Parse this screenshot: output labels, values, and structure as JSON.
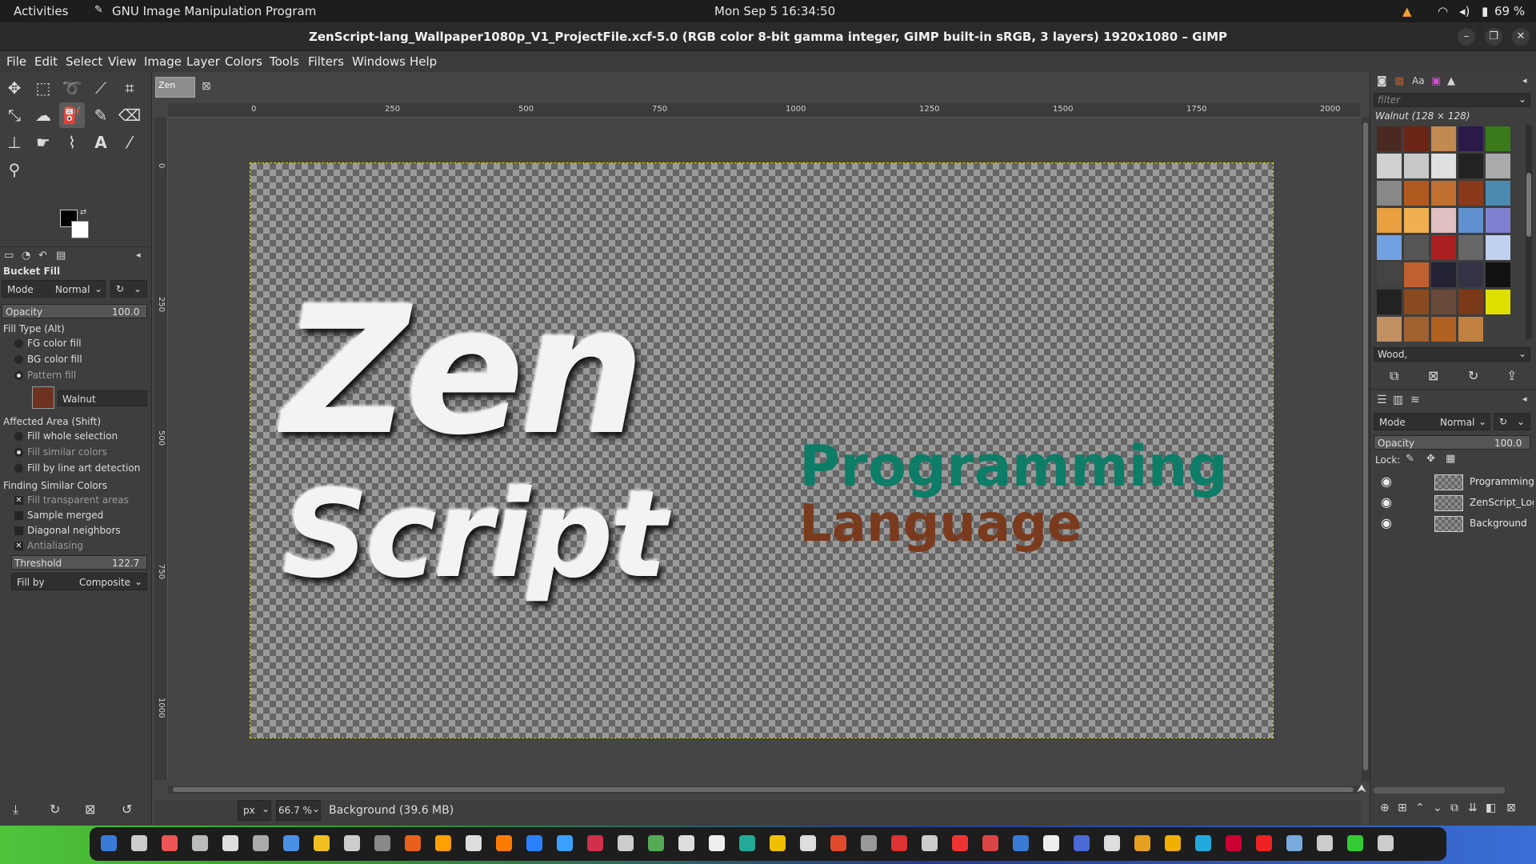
{
  "system_bar": {
    "activities": "Activities",
    "app_name": "GNU Image Manipulation Program",
    "clock": "Mon Sep 5  16:34:50",
    "battery": "69 %"
  },
  "window": {
    "title": "ZenScript-lang_Wallpaper1080p_V1_ProjectFile.xcf-5.0 (RGB color 8-bit gamma integer, GIMP built-in sRGB, 3 layers) 1920x1080 – GIMP"
  },
  "menu": [
    "File",
    "Edit",
    "Select",
    "View",
    "Image",
    "Layer",
    "Colors",
    "Tools",
    "Filters",
    "Windows",
    "Help"
  ],
  "image_tab": {
    "label": "Zen"
  },
  "tool_options": {
    "title": "Bucket Fill",
    "mode_label": "Mode",
    "mode_value": "Normal",
    "opacity_label": "Opacity",
    "opacity_value": "100.0",
    "fill_type_label": "Fill Type  (Alt)",
    "fill_types": [
      "FG color fill",
      "BG color fill",
      "Pattern fill"
    ],
    "pattern_name": "Walnut",
    "affected_area_label": "Affected Area  (Shift)",
    "affected_areas": [
      "Fill whole selection",
      "Fill similar colors",
      "Fill by line art detection"
    ],
    "finding_label": "Finding Similar Colors",
    "finding_options": [
      "Fill transparent areas",
      "Sample merged",
      "Diagonal neighbors",
      "Antialiasing"
    ],
    "threshold_label": "Threshold",
    "threshold_value": "122.7",
    "fill_by_label": "Fill by",
    "fill_by_value": "Composite"
  },
  "ruler": {
    "h_ticks": [
      "0",
      "250",
      "500",
      "750",
      "1000",
      "1250",
      "1500",
      "1750",
      "2000"
    ],
    "v_ticks": [
      "0",
      "250",
      "500",
      "750",
      "1000"
    ]
  },
  "canvas_text": {
    "logo_line1": "Zen",
    "logo_line2": "Script",
    "line1": "Programming",
    "line2": "Language"
  },
  "status": {
    "unit": "px",
    "zoom": "66.7 %",
    "info": "Background (39.6 MB)"
  },
  "patterns_panel": {
    "filter_placeholder": "filter",
    "selected_label": "Walnut (128 × 128)",
    "tag_value": "Wood,"
  },
  "layers_panel": {
    "mode_label": "Mode",
    "mode_value": "Normal",
    "opacity_label": "Opacity",
    "opacity_value": "100.0",
    "lock_label": "Lock:",
    "layers": [
      "Programming",
      "ZenScript_Log",
      "Background"
    ]
  },
  "colors": {
    "accent_green": "#0d7d67",
    "accent_brown": "#7a3a1d",
    "selection_outline": "#d8d800"
  }
}
